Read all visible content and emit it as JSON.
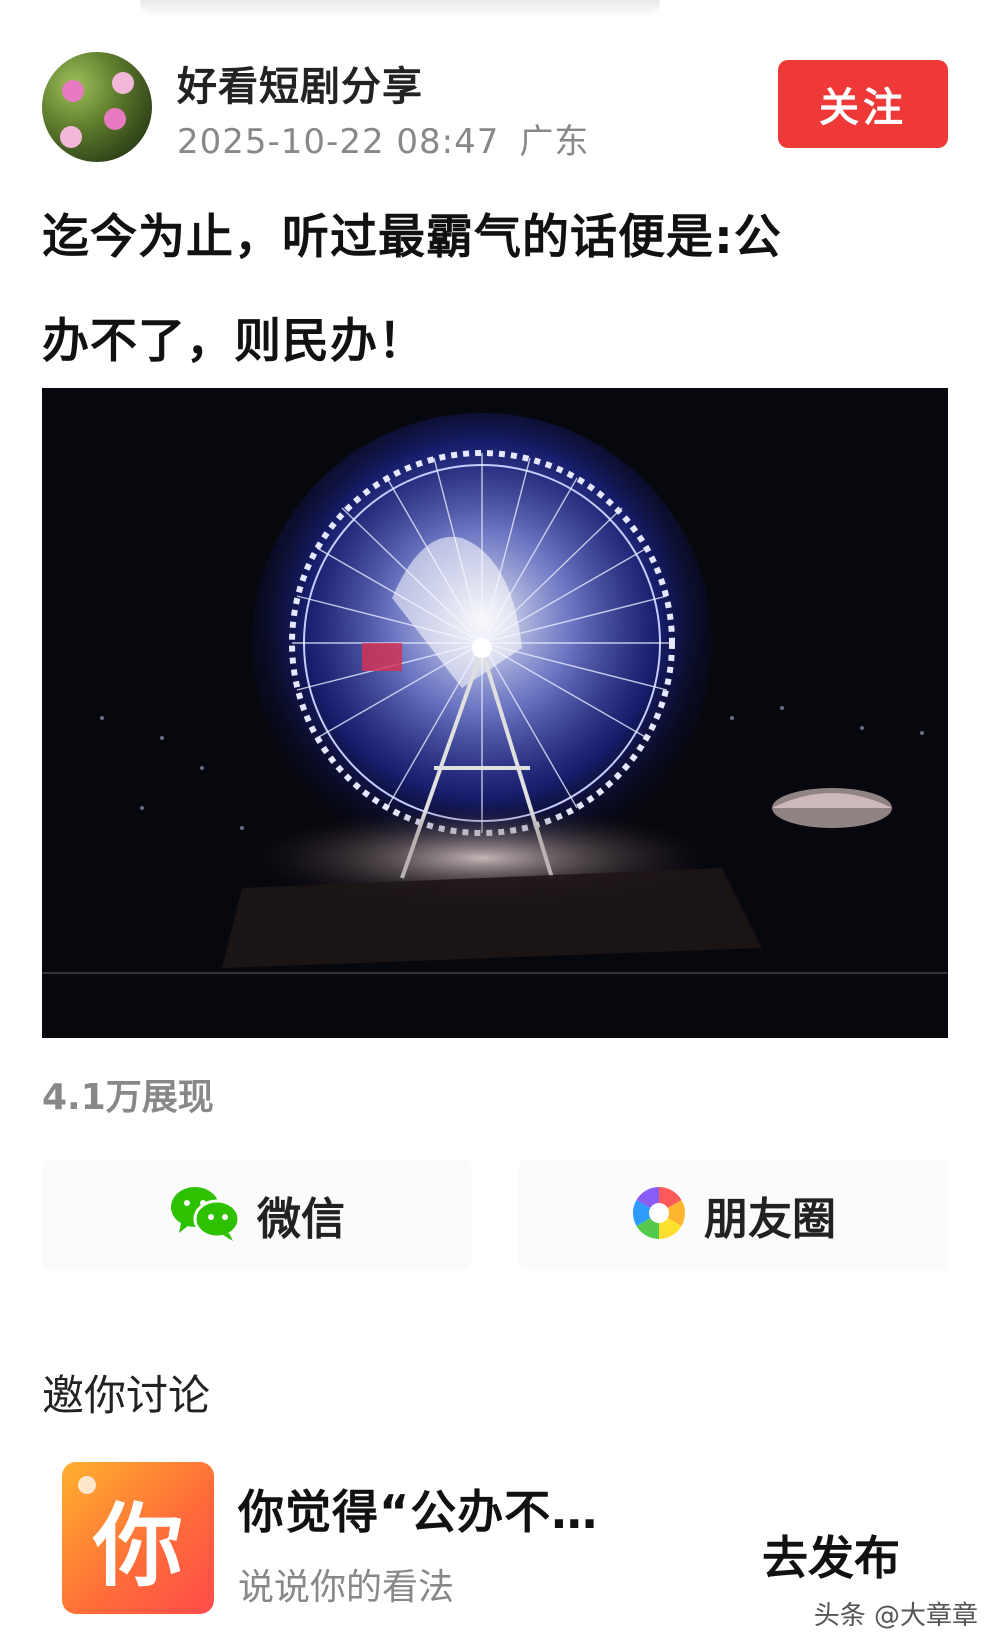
{
  "header": {
    "author": "好看短剧分享",
    "timestamp": "2025-10-22 08:47",
    "region": "广东",
    "follow_label": "关注"
  },
  "post": {
    "title_line1": "迄今为止，听过最霸气的话便是:公",
    "title_line2": "办不了，则民办！",
    "views": "4.1万展现"
  },
  "share": {
    "wechat_label": "微信",
    "moments_label": "朋友圈"
  },
  "discuss": {
    "section_title": "邀你讨论",
    "icon_char": "你",
    "prompt_text": "你觉得“公办不…",
    "prompt_sub": "说说你的看法",
    "publish_label": "去发布"
  },
  "watermark": "头条 @大章章",
  "colors": {
    "follow_red": "#ef3838",
    "wechat_green": "#2dc100",
    "icon_orange": "#ff8a2e"
  }
}
